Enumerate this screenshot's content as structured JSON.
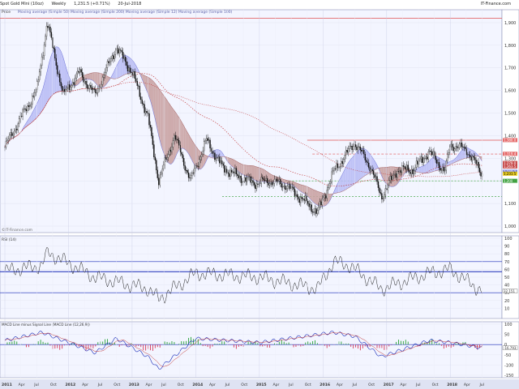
{
  "header": {
    "instrument": "Spot Gold Mini (10oz)",
    "timeframe": "Weekly",
    "change": "1,231.5 (+0.71%)",
    "date": "20-Jul-2018",
    "source_right": "IT-Finance.com"
  },
  "price_panel": {
    "label": "Price",
    "legend": "Moving average (Simple 50) Moving average (Simple 200) Moving average (Simple 12) Moving average (Simple 100)",
    "watermark": "©IT-Finance.com",
    "y_ticks": [
      "1,900",
      "1,800",
      "1,700",
      "1,600",
      "1,500",
      "1,400",
      "1,300",
      "1,200",
      "1,100",
      "1,000"
    ],
    "right_tags": [
      "1,380.0",
      "1,319.4",
      "1,279.0",
      "1,263.5",
      "1,240.2",
      "1,231.5",
      "1,200"
    ]
  },
  "rsi_panel": {
    "label": "RSI (14)",
    "y_ticks": [
      "100",
      "90",
      "80",
      "70",
      "60",
      "50",
      "40",
      "30",
      "20",
      "10"
    ],
    "current_tag": "32.151"
  },
  "macd_panel": {
    "label": "MACD Line minus Signal Line (MACD Line (12,26,9))",
    "y_ticks": [
      "100",
      "50",
      "0",
      "-50",
      "-100",
      "-150"
    ],
    "current_tag": "-16.793"
  },
  "time_axis": [
    "2011",
    "Apr",
    "Jul",
    "Oct",
    "2012",
    "Apr",
    "Jul",
    "Oct",
    "2013",
    "Apr",
    "Jul",
    "Oct",
    "2014",
    "Apr",
    "Jul",
    "Oct",
    "2015",
    "Apr",
    "Jul",
    "Oct",
    "2016",
    "Apr",
    "Jul",
    "Oct",
    "2017",
    "Apr",
    "Jul",
    "Oct",
    "2018",
    "Apr",
    "Jul"
  ],
  "chart_data": {
    "type": "line",
    "x_range": [
      "2011-01",
      "2018-07"
    ],
    "ylim": [
      1000,
      1950
    ],
    "price_series": {
      "name": "Spot Gold Mini (10oz)",
      "x": [
        "2011-01",
        "2011-04",
        "2011-07",
        "2011-09",
        "2011-12",
        "2012-03",
        "2012-06",
        "2012-10",
        "2013-01",
        "2013-04",
        "2013-06",
        "2013-09",
        "2013-12",
        "2014-03",
        "2014-06",
        "2014-09",
        "2014-12",
        "2015-03",
        "2015-06",
        "2015-09",
        "2015-12",
        "2016-03",
        "2016-07",
        "2016-10",
        "2016-12",
        "2017-03",
        "2017-06",
        "2017-09",
        "2017-12",
        "2018-01",
        "2018-04",
        "2018-07"
      ],
      "values": [
        1350,
        1480,
        1600,
        1900,
        1580,
        1680,
        1580,
        1790,
        1680,
        1480,
        1200,
        1400,
        1200,
        1380,
        1260,
        1220,
        1190,
        1200,
        1180,
        1120,
        1060,
        1240,
        1370,
        1260,
        1130,
        1250,
        1250,
        1330,
        1240,
        1360,
        1340,
        1231.5
      ]
    },
    "levels": {
      "all_time_high": 1920,
      "resistance": 1380,
      "support_upper": 1200,
      "support_lower": 1130
    },
    "rsi": {
      "x": [
        "2011-01",
        "2011-08",
        "2011-09",
        "2012-06",
        "2013-04",
        "2013-06",
        "2014-01",
        "2015-01",
        "2015-12",
        "2016-03",
        "2016-06",
        "2016-12",
        "2017-09",
        "2018-01",
        "2018-07"
      ],
      "values": [
        58,
        65,
        82,
        50,
        35,
        22,
        55,
        50,
        35,
        70,
        65,
        35,
        55,
        60,
        32
      ],
      "bands": [
        30,
        70
      ]
    },
    "macd": {
      "x": [
        "2011-01",
        "2011-08",
        "2012-06",
        "2012-10",
        "2013-04",
        "2013-06",
        "2014-01",
        "2015-01",
        "2016-03",
        "2016-07",
        "2016-12",
        "2017-09",
        "2018-01",
        "2018-07"
      ],
      "values": [
        20,
        60,
        -40,
        30,
        -60,
        -120,
        30,
        10,
        60,
        40,
        -60,
        20,
        10,
        -16.793
      ]
    }
  }
}
